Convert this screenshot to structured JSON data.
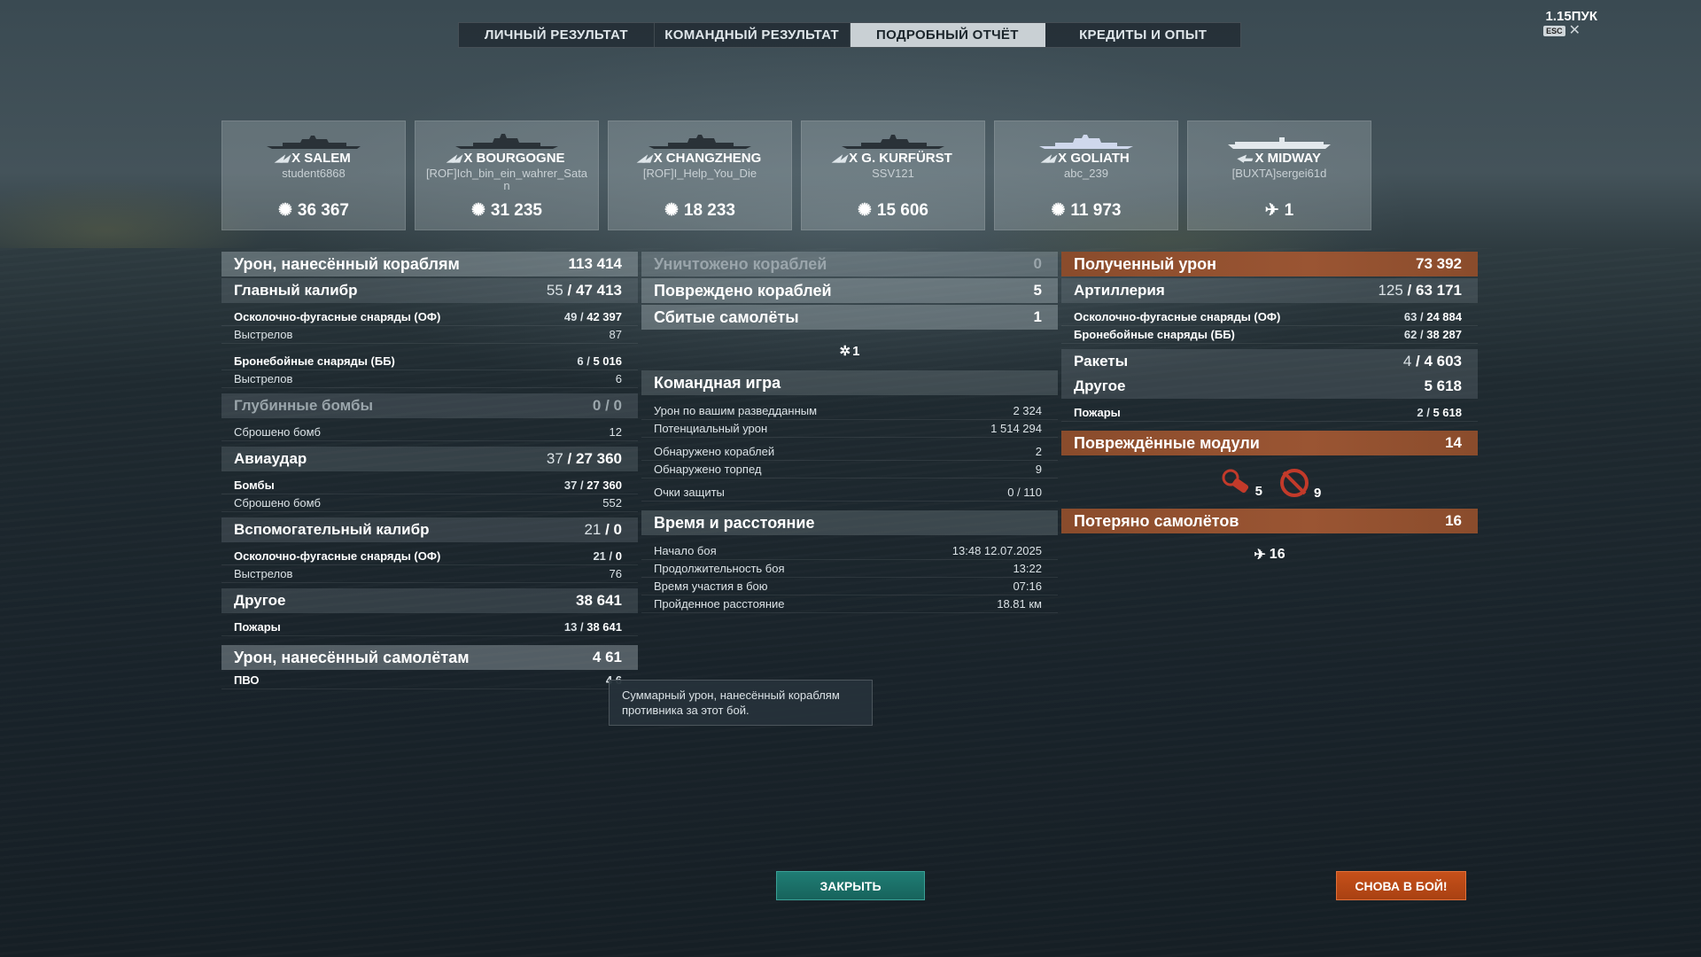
{
  "colors": {
    "accent_teal": "#1f7d74",
    "accent_orange": "#c6501a",
    "header_orange": "#9a5533",
    "tab_active": "#c9d0d4"
  },
  "tabs": [
    "ЛИЧНЫЙ РЕЗУЛЬТАТ",
    "КОМАНДНЫЙ РЕЗУЛЬТАТ",
    "ПОДРОБНЫЙ ОТЧЁТ",
    "КРЕДИТЫ И ОПЫТ"
  ],
  "active_tab": "ПОДРОБНЫЙ ОТЧЁТ",
  "version": "1.15ПУК",
  "esc_label": "ESC",
  "cards": [
    {
      "ship": "X SALEM",
      "player": "student6868",
      "value": "36 367",
      "icon": "damage-icon"
    },
    {
      "ship": "X BOURGOGNE",
      "player": "[ROF]Ich_bin_ein_wahrer_Satan",
      "value": "31 235",
      "icon": "damage-icon"
    },
    {
      "ship": "X CHANGZHENG",
      "player": "[ROF]I_Help_You_Die",
      "value": "18 233",
      "icon": "damage-icon"
    },
    {
      "ship": "X G. KURFÜRST",
      "player": "SSV121",
      "value": "15 606",
      "icon": "damage-icon"
    },
    {
      "ship": "X GOLIATH",
      "player": "abc_239",
      "value": "11 973",
      "icon": "damage-icon"
    },
    {
      "ship": "X MIDWAY",
      "player": "[BUXTA]sergei61d",
      "value": "1",
      "icon": "plane-kill-icon"
    }
  ],
  "left": {
    "ship_damage": {
      "label": "Урон, нанесённый кораблям",
      "value": "113 414"
    },
    "main_battery": {
      "label": "Главный калибр",
      "n": "55",
      "v": "47 413"
    },
    "mb_he": {
      "label": "Осколочно-фугасные снаряды (ОФ)",
      "n": "49",
      "v": "42 397"
    },
    "mb_he_shots": {
      "label": "Выстрелов",
      "value": "87"
    },
    "mb_ap": {
      "label": "Бронебойные снаряды (ББ)",
      "n": "6",
      "v": "5 016"
    },
    "mb_ap_shots": {
      "label": "Выстрелов",
      "value": "6"
    },
    "depth": {
      "label": "Глубинные бомбы",
      "value": "0 / 0"
    },
    "depth_dropped": {
      "label": "Сброшено бомб",
      "value": "12"
    },
    "air": {
      "label": "Авиаудар",
      "n": "37",
      "v": "27 360"
    },
    "air_bombs": {
      "label": "Бомбы",
      "n": "37",
      "v": "27 360"
    },
    "air_dropped": {
      "label": "Сброшено бомб",
      "value": "552"
    },
    "secondary": {
      "label": "Вспомогательный калибр",
      "n": "21",
      "v": "0"
    },
    "sec_he": {
      "label": "Осколочно-фугасные снаряды (ОФ)",
      "n": "21",
      "v": "0"
    },
    "sec_shots": {
      "label": "Выстрелов",
      "value": "76"
    },
    "other": {
      "label": "Другое",
      "value": "38 641"
    },
    "fires": {
      "label": "Пожары",
      "n": "13",
      "v": "38 641"
    },
    "plane_damage": {
      "label": "Урон, нанесённый самолётам",
      "value": "4 61"
    },
    "aa": {
      "label": "ПВО",
      "value": "4 6"
    }
  },
  "mid": {
    "destroyed": {
      "label": "Уничтожено кораблей",
      "value": "0"
    },
    "damaged": {
      "label": "Повреждено кораблей",
      "value": "5"
    },
    "planes_shot": {
      "label": "Сбитые самолёты",
      "value": "1"
    },
    "planes_icon_count": "1",
    "team": {
      "label": "Командная игра"
    },
    "spotting_dmg": {
      "label": "Урон по вашим разведданным",
      "value": "2 324"
    },
    "potential_dmg": {
      "label": "Потенциальный урон",
      "value": "1 514 294"
    },
    "ships_spotted": {
      "label": "Обнаружено кораблей",
      "value": "2"
    },
    "torps_spotted": {
      "label": "Обнаружено торпед",
      "value": "9"
    },
    "defense_pts": {
      "label": "Очки защиты",
      "value": "0 / 110"
    },
    "time": {
      "label": "Время и расстояние"
    },
    "battle_start": {
      "label": "Начало боя",
      "value": "13:48  12.07.2025"
    },
    "battle_len": {
      "label": "Продолжительность боя",
      "value": "13:22"
    },
    "participation": {
      "label": "Время участия в бою",
      "value": "07:16"
    },
    "distance": {
      "label": "Пройденное расстояние",
      "value": "18.81 км"
    }
  },
  "right": {
    "received": {
      "label": "Полученный урон",
      "value": "73 392"
    },
    "artillery": {
      "label": "Артиллерия",
      "n": "125",
      "v": "63 171"
    },
    "art_he": {
      "label": "Осколочно-фугасные снаряды (ОФ)",
      "n": "63",
      "v": "24 884"
    },
    "art_ap": {
      "label": "Бронебойные снаряды (ББ)",
      "n": "62",
      "v": "38 287"
    },
    "rockets": {
      "label": "Ракеты",
      "n": "4",
      "v": "4 603"
    },
    "other": {
      "label": "Другое",
      "value": "5 618"
    },
    "fires": {
      "label": "Пожары",
      "n": "2",
      "v": "5 618"
    },
    "modules": {
      "label": "Повреждённые модули",
      "value": "14"
    },
    "module_a": "5",
    "module_b": "9",
    "lost": {
      "label": "Потеряно самолётов",
      "value": "16"
    },
    "lost_icon_count": "16"
  },
  "tooltip": "Суммарный урон, нанесённый кораблям противника за этот бой.",
  "buttons": {
    "close": "ЗАКРЫТЬ",
    "again": "СНОВА В БОЙ!"
  }
}
